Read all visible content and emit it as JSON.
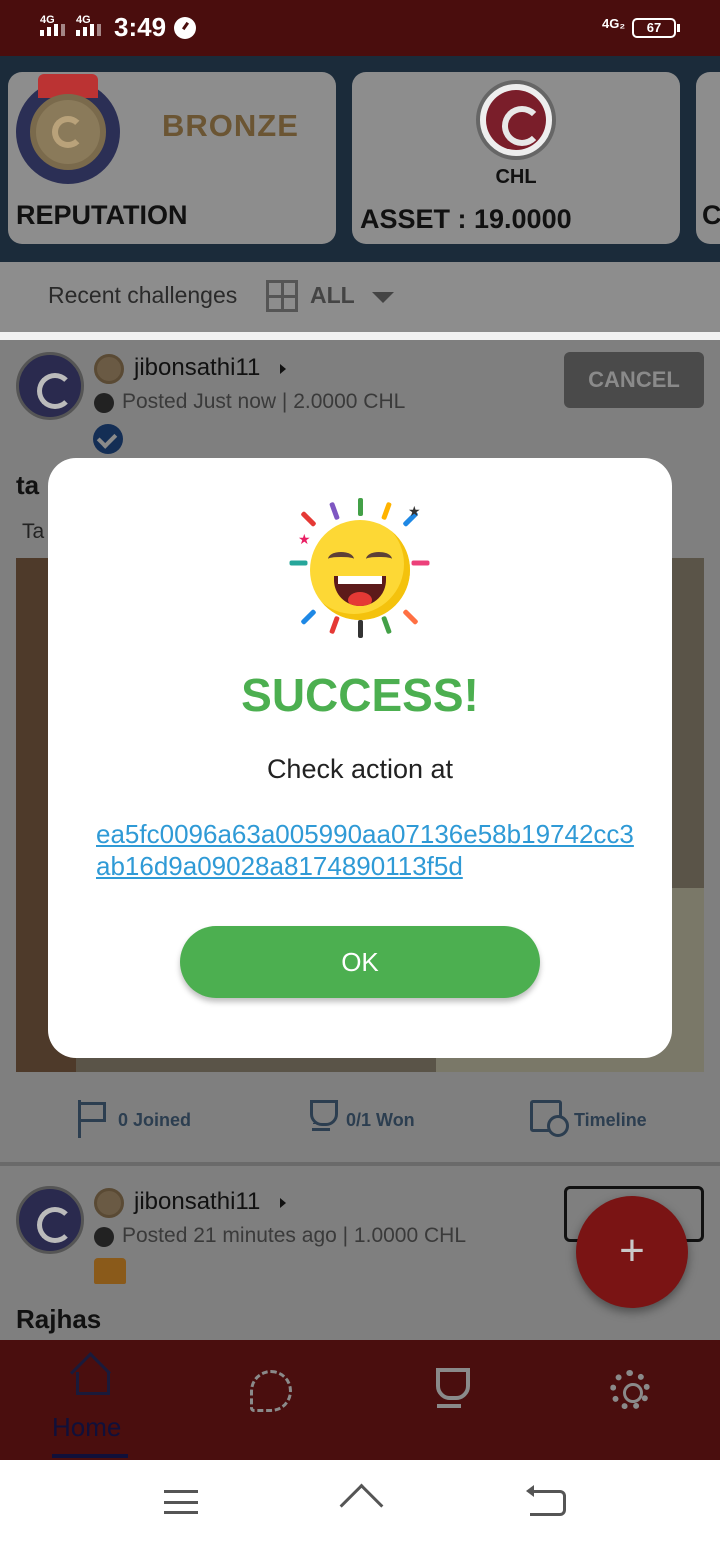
{
  "status_bar": {
    "network1": "4G",
    "network2": "4G",
    "time": "3:49",
    "network3": "4G₂",
    "battery": "67"
  },
  "header_cards": {
    "reputation_tier": "BRONZE",
    "reputation_label": "REPUTATION",
    "coin_symbol": "CHL",
    "asset_label": "ASSET : 19.0000",
    "third_card_partial": "C"
  },
  "filter": {
    "title": "Recent challenges",
    "selected": "ALL"
  },
  "posts": [
    {
      "username": "jibonsathi11",
      "meta": "Posted Just now | 2.0000 CHL",
      "action_label": "CANCEL",
      "title_partial": "ta",
      "subtitle_partial": "Ta",
      "stats": {
        "joined": "0 Joined",
        "won": "0/1 Won",
        "timeline": "Timeline"
      }
    },
    {
      "username": "jibonsathi11",
      "meta": "Posted 21 minutes ago | 1.0000 CHL",
      "title": "Rajhas"
    }
  ],
  "fab_label": "+",
  "bottom_nav": {
    "home": "Home"
  },
  "dialog": {
    "heading": "SUCCESS!",
    "message": "Check action at",
    "tx_hash": "ea5fc0096a63a005990aa07136e58b19742cc3ab16d9a09028a8174890113f5d",
    "ok_label": "OK"
  },
  "colors": {
    "success_green": "#4caf50",
    "link_blue": "#2f9ad6",
    "brand_dark_red": "#4a0d0d"
  }
}
